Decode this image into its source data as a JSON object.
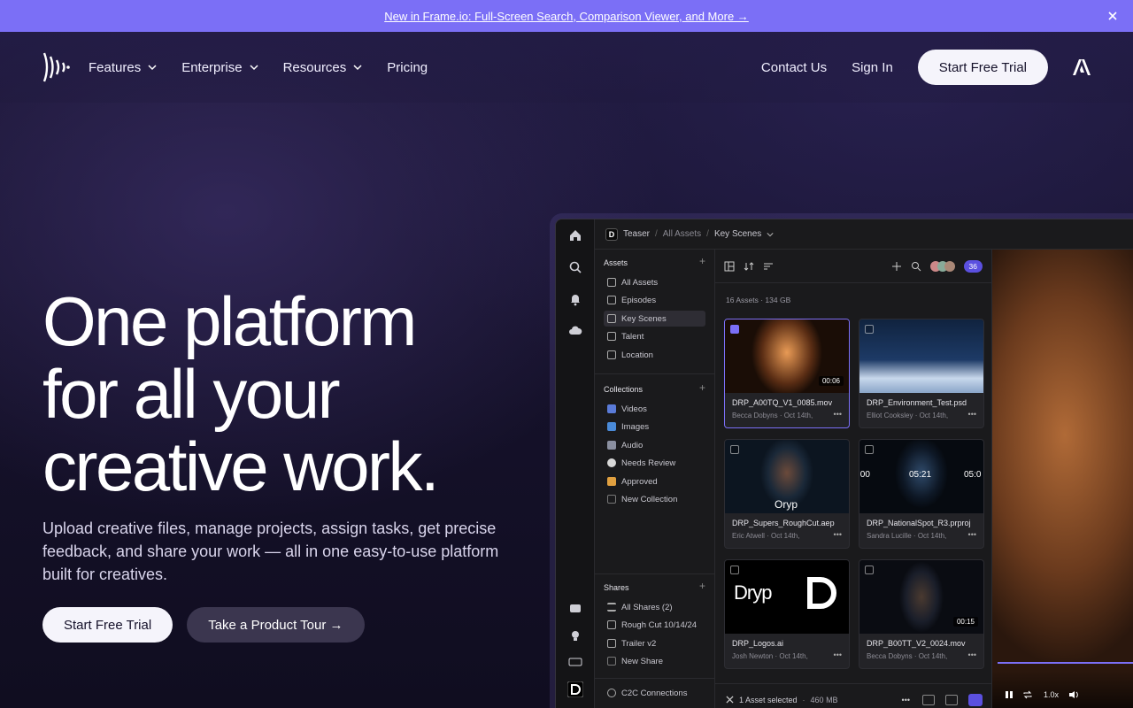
{
  "announcement": {
    "text": "New in Frame.io: Full-Screen Search, Comparison Viewer, and More →"
  },
  "nav": {
    "left": [
      {
        "label": "Features",
        "dropdown": true
      },
      {
        "label": "Enterprise",
        "dropdown": true
      },
      {
        "label": "Resources",
        "dropdown": true
      },
      {
        "label": "Pricing",
        "dropdown": false
      }
    ],
    "contact": "Contact Us",
    "sign_in": "Sign In",
    "cta": "Start Free Trial"
  },
  "hero": {
    "title_lines": [
      "One platform",
      "for all your",
      "creative work."
    ],
    "subtitle": "Upload creative files, manage projects, assign tasks, get precise feedback, and share your work — all in one easy-to-use platform built for creatives.",
    "cta_primary": "Start Free Trial",
    "cta_secondary": "Take a Product Tour →"
  },
  "app": {
    "breadcrumb": {
      "project": "Teaser",
      "middle": "All Assets",
      "current": "Key Scenes"
    },
    "sidebar": {
      "assets_header": "Assets",
      "assets": [
        "All Assets",
        "Episodes",
        "Key Scenes",
        "Talent",
        "Location"
      ],
      "collections_header": "Collections",
      "collections": [
        "Videos",
        "Images",
        "Audio",
        "Needs Review",
        "Approved",
        "New Collection"
      ],
      "shares_header": "Shares",
      "shares": [
        "All Shares (2)",
        "Rough Cut 10/14/24",
        "Trailer v2",
        "New Share"
      ],
      "c2c": "C2C Connections"
    },
    "toolbar": {
      "member_count": "36"
    },
    "assets_summary": "16 Assets  ·  134 GB",
    "cards": [
      {
        "name": "DRP_A00TQ_V1_0085.mov",
        "author": "Becca Dobyns",
        "date": "Oct 14th,",
        "duration": "00:06",
        "selected": true
      },
      {
        "name": "DRP_Environment_Test.psd",
        "author": "Elliot Cooksley",
        "date": "Oct 14th,",
        "duration": "",
        "selected": false
      },
      {
        "name": "DRP_Supers_RoughCut.aep",
        "author": "Eric Atwell",
        "date": "Oct 14th,",
        "duration": "",
        "selected": false
      },
      {
        "name": "DRP_NationalSpot_R3.prproj",
        "author": "Sandra Lucille",
        "date": "Oct 14th,",
        "duration": "",
        "selected": false
      },
      {
        "name": "DRP_Logos.ai",
        "author": "Josh Newton",
        "date": "Oct 14th,",
        "duration": "",
        "selected": false
      },
      {
        "name": "DRP_B00TT_V2_0024.mov",
        "author": "Becca Dobyns",
        "date": "Oct 14th,",
        "duration": "00:15",
        "selected": false
      }
    ],
    "thumb_texts": {
      "oryp": "Oryp",
      "dryp": "Dryp",
      "timecodes": [
        ":00",
        "05:21",
        "05:0"
      ]
    },
    "selection_bar": {
      "text": "1 Asset selected",
      "size": "460 MB"
    },
    "player": {
      "speed": "1.0x",
      "progress": 0.9
    }
  },
  "colors": {
    "accent": "#7b6ff6",
    "bg": "#15112a"
  }
}
